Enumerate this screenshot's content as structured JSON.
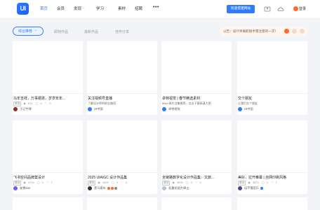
{
  "header": {
    "logo": "UI",
    "nav": [
      {
        "label": "首页",
        "active": true,
        "dropdown": false
      },
      {
        "label": "会员",
        "active": false,
        "dropdown": false
      },
      {
        "label": "发现",
        "active": false,
        "dropdown": true
      },
      {
        "label": "学习",
        "active": false,
        "dropdown": true
      },
      {
        "label": "素材",
        "active": false,
        "dropdown": false
      },
      {
        "label": "招聘",
        "active": false,
        "dropdown": false
      }
    ],
    "more": "•••",
    "create_button": "快速搭建网站",
    "login": "登录"
  },
  "filters": {
    "main": "综合推荐",
    "tabs": [
      "即刻作品",
      "最新作品",
      "佳作分享"
    ]
  },
  "notice": {
    "text": "公告：设计师离职接手需注意的一次！"
  },
  "cards": [
    {
      "title": "马年吉祥，万事顺遂，岁岁年年...",
      "tag": "原创",
      "views": "874",
      "comments": "0",
      "likes": "0",
      "author": "于辽宇律",
      "avatar_color": "#8b2e1f",
      "badges": []
    },
    {
      "title": "关注视频号直播",
      "desc": "了解设计师的职业路径",
      "author": "UI中国",
      "avatar_color": "#2f7cff",
      "badges": []
    },
    {
      "title": "卓特视觉 | 春节精选素材",
      "desc": "50w+高片点集推荐，点击下载高清大图",
      "author": "卓特视觉",
      "avatar_color": "#2f7cff",
      "badges": []
    },
    {
      "title": "交个朋友",
      "desc": "让我们交个朋友",
      "author": "UI中国",
      "avatar_color": "#2f7cff",
      "badges": []
    },
    {
      "title": "飞书空间品牌案设计",
      "tag": "原创",
      "views": "4734",
      "comments": "0",
      "likes": "1",
      "author": "安想aoo",
      "avatar_color": "#6b5cff",
      "badges": []
    },
    {
      "title": "2025 UIAIGC 设计作品集",
      "tag": "原创",
      "views": "4405",
      "comments": "0",
      "likes": "4",
      "author": "黑马青年",
      "avatar_color": "#333333",
      "badges": [
        "#ff6a2a",
        "#ff6a2a",
        "#8a8a8a"
      ]
    },
    {
      "title": "全链路数字化设计作品集：文旅...",
      "tag": "原创",
      "views": "3535",
      "comments": "0",
      "likes": "0",
      "author": "无量花园大律士",
      "avatar_color": "#b8c3cf",
      "badges": []
    },
    {
      "title": "美好，拉开帷幕 | 丝网印刷风格",
      "tag": "原创",
      "views": "3674",
      "comments": "0",
      "likes": "1",
      "author": "玩不懂音乐",
      "avatar_color": "#4a4a8a",
      "badges": [
        "#2f7cff"
      ]
    }
  ],
  "colors": {
    "accent": "#2f7cff",
    "notice_orange": "#ff6a2a"
  },
  "icons": {
    "views": "eye-icon",
    "comments": "comment-icon",
    "likes": "heart-icon"
  }
}
